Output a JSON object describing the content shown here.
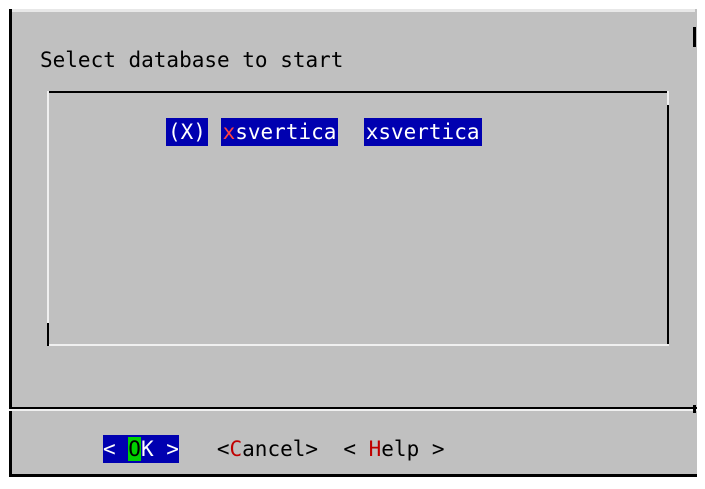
{
  "dialog": {
    "prompt": "Select database to start"
  },
  "list": {
    "items": [
      {
        "marker": "(X)",
        "name_hotkey": "x",
        "name_rest": "svertica",
        "description": "xsvertica"
      }
    ]
  },
  "buttons": {
    "ok": {
      "left": "< ",
      "hotkey": "O",
      "rest": "K",
      "right": " >"
    },
    "cancel": {
      "left": "<",
      "hotkey": "C",
      "rest": "ancel",
      "right": ">"
    },
    "help": {
      "left": "< ",
      "hotkey": "H",
      "rest": "elp",
      "right": " >"
    }
  },
  "colors": {
    "dialog_bg": "#c0c0c0",
    "selection_bg": "#0000b0",
    "hotkey": "#ff4040",
    "ok_hotkey_bg": "#00d000"
  }
}
